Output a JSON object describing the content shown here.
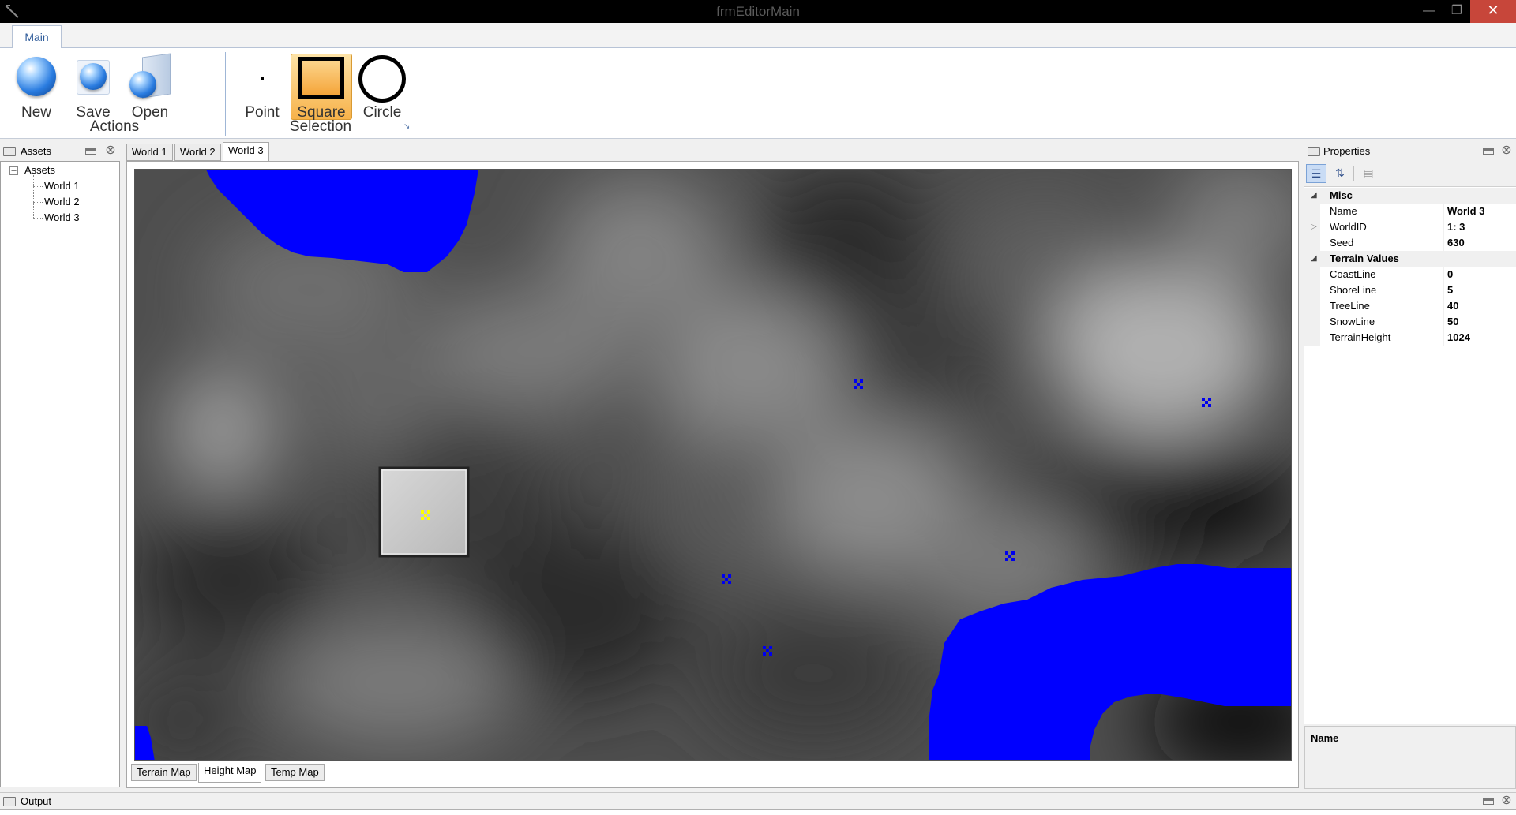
{
  "window": {
    "title": "frmEditorMain"
  },
  "ribbon": {
    "tab": "Main",
    "actions": {
      "group_label": "Actions",
      "new_label": "New",
      "save_label": "Save",
      "open_label": "Open"
    },
    "selection": {
      "group_label": "Selection",
      "point_label": "Point",
      "square_label": "Square",
      "circle_label": "Circle",
      "active_tool": "Square"
    }
  },
  "assets_panel": {
    "title": "Assets",
    "root": "Assets",
    "items": [
      "World 1",
      "World 2",
      "World 3"
    ]
  },
  "document_tabs": [
    "World 1",
    "World 2",
    "World 3"
  ],
  "active_document": "World 3",
  "map_tabs": [
    "Terrain Map",
    "Height Map",
    "Temp Map"
  ],
  "active_map_tab": "Height Map",
  "properties_panel": {
    "title": "Properties",
    "categories": [
      {
        "name": "Misc",
        "rows": [
          {
            "name": "Name",
            "value": "World 3"
          },
          {
            "name": "WorldID",
            "value": "1: 3",
            "expandable": true
          },
          {
            "name": "Seed",
            "value": "630"
          }
        ]
      },
      {
        "name": "Terrain Values",
        "rows": [
          {
            "name": "CoastLine",
            "value": "0"
          },
          {
            "name": "ShoreLine",
            "value": "5"
          },
          {
            "name": "TreeLine",
            "value": "40"
          },
          {
            "name": "SnowLine",
            "value": "50"
          },
          {
            "name": "TerrainHeight",
            "value": "1024"
          }
        ]
      }
    ],
    "description_title": "Name"
  },
  "output_panel": {
    "title": "Output"
  },
  "colors": {
    "water": "#0000ff",
    "marker": "#0000ee",
    "selected_marker": "#ffff00",
    "active_tool_bg": "#f7b24a"
  }
}
